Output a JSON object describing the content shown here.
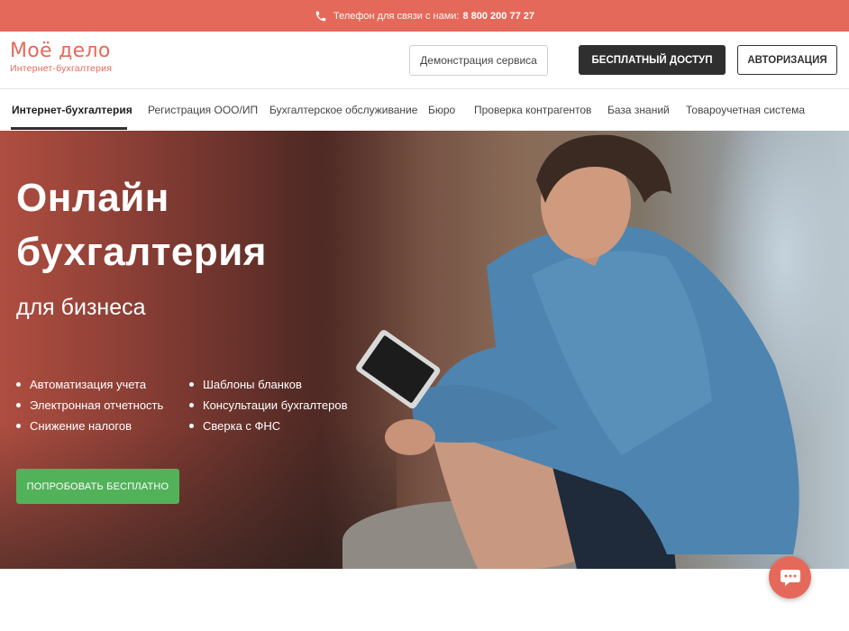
{
  "topbar": {
    "phone_label": "Телефон для связи с нами:",
    "phone_number": "8 800 200 77 27",
    "icon": "phone-icon"
  },
  "header": {
    "logo_title": "Моё дело",
    "logo_subtitle": "Интернет-бухгалтерия",
    "demo_button": "Демонстрация сервиса",
    "free_button": "БЕСПЛАТНЫЙ ДОСТУП",
    "auth_button": "АВТОРИЗАЦИЯ"
  },
  "nav": {
    "items": [
      {
        "label": "Интернет-бухгалтерия",
        "active": true
      },
      {
        "label": "Регистрация ООО/ИП"
      },
      {
        "label": "Бухгалтерское обслуживание"
      },
      {
        "label": "Бюро"
      },
      {
        "label": "Проверка контрагентов"
      },
      {
        "label": "База знаний"
      },
      {
        "label": "Товароучетная система"
      }
    ]
  },
  "hero": {
    "title_line1": "Онлайн",
    "title_line2": "бухгалтерия",
    "subtitle": "для бизнеса",
    "features_col1": [
      "Автоматизация учета",
      "Электронная отчетность",
      "Снижение налогов"
    ],
    "features_col2": [
      "Шаблоны бланков",
      "Консультации бухгалтеров",
      "Сверка с ФНС"
    ],
    "cta": "ПОПРОБОВАТЬ БЕСПЛАТНО"
  },
  "chat": {
    "icon": "chat-bubble-icon"
  },
  "colors": {
    "brand": "#e5695a",
    "dark_button": "#2f2f2f",
    "cta_green": "#52b25a"
  }
}
